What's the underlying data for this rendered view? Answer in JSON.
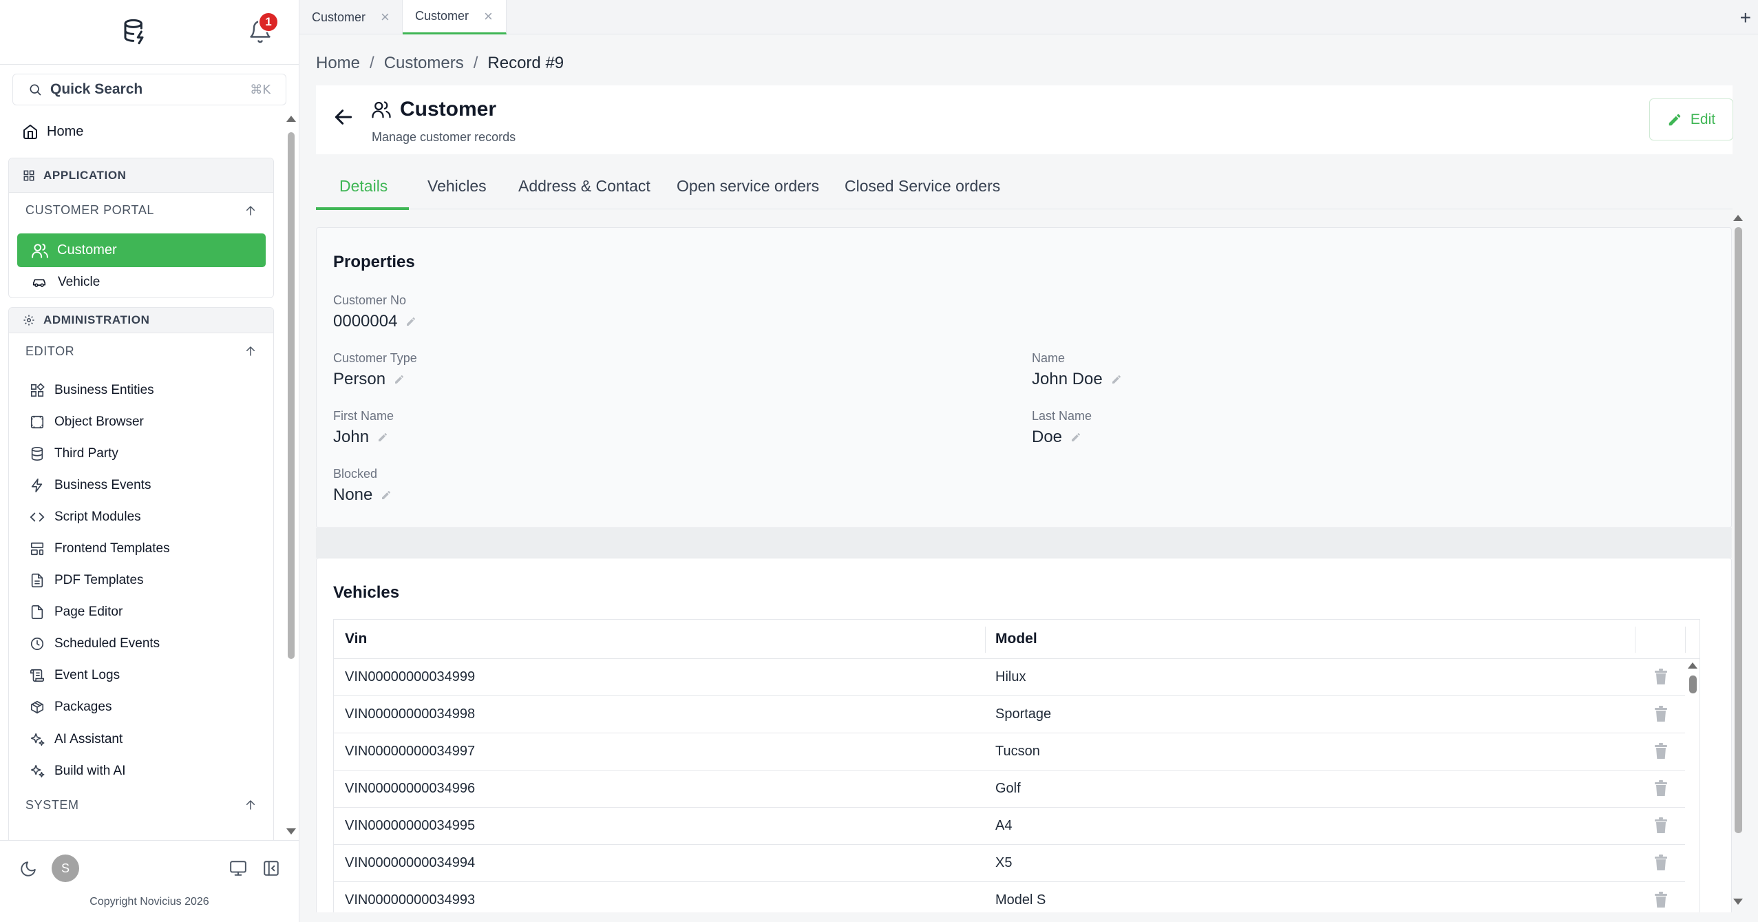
{
  "sidebar": {
    "notification_count": "1",
    "search_label": "Quick Search",
    "search_shortcut": "⌘K",
    "home_label": "Home",
    "application_header": "APPLICATION",
    "customer_portal_label": "CUSTOMER PORTAL",
    "customer_item": "Customer",
    "vehicle_item": "Vehicle",
    "administration_header": "ADMINISTRATION",
    "editor_label": "EDITOR",
    "editor_items": [
      {
        "label": "Business Entities",
        "icon": "business-entities-icon"
      },
      {
        "label": "Object Browser",
        "icon": "object-browser-icon"
      },
      {
        "label": "Third Party",
        "icon": "database-icon"
      },
      {
        "label": "Business Events",
        "icon": "lightning-icon"
      },
      {
        "label": "Script Modules",
        "icon": "code-icon"
      },
      {
        "label": "Frontend Templates",
        "icon": "layout-template-icon"
      },
      {
        "label": "PDF Templates",
        "icon": "file-text-icon"
      },
      {
        "label": "Page Editor",
        "icon": "file-icon"
      },
      {
        "label": "Scheduled Events",
        "icon": "clock-icon"
      },
      {
        "label": "Event Logs",
        "icon": "scroll-icon"
      },
      {
        "label": "Packages",
        "icon": "package-icon"
      },
      {
        "label": "AI Assistant",
        "icon": "sparkles-icon"
      },
      {
        "label": "Build with AI",
        "icon": "sparkles-icon"
      }
    ],
    "system_label": "SYSTEM",
    "avatar_initial": "S",
    "copyright": "Copyright Novicius 2026"
  },
  "tabs": [
    {
      "label": "Customer",
      "active": false
    },
    {
      "label": "Customer",
      "active": true
    }
  ],
  "breadcrumb": {
    "home": "Home",
    "customers": "Customers",
    "current": "Record #9"
  },
  "header": {
    "title": "Customer",
    "subtitle": "Manage customer records",
    "edit_label": "Edit"
  },
  "subtabs": [
    "Details",
    "Vehicles",
    "Address & Contact",
    "Open service orders",
    "Closed Service orders"
  ],
  "properties": {
    "title": "Properties",
    "customer_no_label": "Customer No",
    "customer_no": "0000004",
    "customer_type_label": "Customer Type",
    "customer_type": "Person",
    "name_label": "Name",
    "name": "John Doe",
    "first_name_label": "First Name",
    "first_name": "John",
    "last_name_label": "Last Name",
    "last_name": "Doe",
    "blocked_label": "Blocked",
    "blocked": "None"
  },
  "vehicles": {
    "title": "Vehicles",
    "columns": [
      "Vin",
      "Model"
    ],
    "rows": [
      {
        "vin": "VIN00000000034999",
        "model": "Hilux"
      },
      {
        "vin": "VIN00000000034998",
        "model": "Sportage"
      },
      {
        "vin": "VIN00000000034997",
        "model": "Tucson"
      },
      {
        "vin": "VIN00000000034996",
        "model": "Golf"
      },
      {
        "vin": "VIN00000000034995",
        "model": "A4"
      },
      {
        "vin": "VIN00000000034994",
        "model": "X5"
      },
      {
        "vin": "VIN00000000034993",
        "model": "Model S"
      }
    ]
  },
  "colors": {
    "accent": "#3fb655",
    "badge": "#dc2626"
  }
}
